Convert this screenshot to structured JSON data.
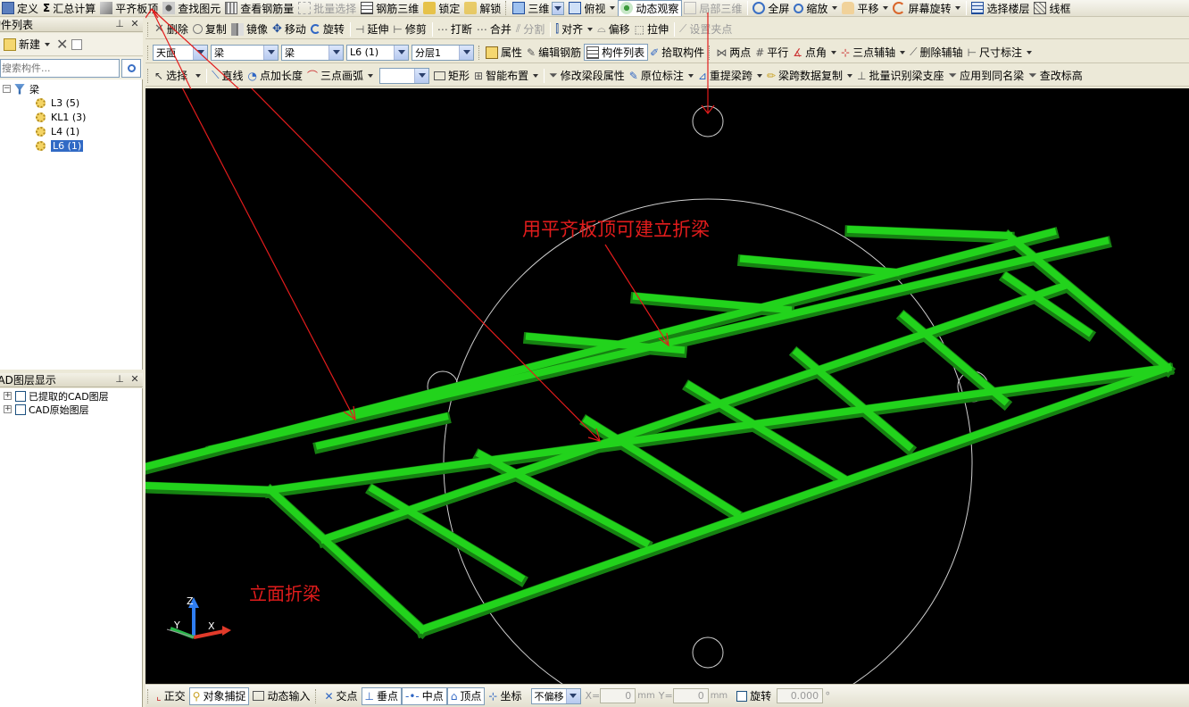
{
  "toolbar1": {
    "define": "定义",
    "sum_calc": "汇总计算",
    "align_board_top": "平齐板顶",
    "find_element": "查找图元",
    "view_rebar_qty": "查看钢筋量",
    "batch_select": "批量选择",
    "rebar_3d": "钢筋三维",
    "lock": "锁定",
    "unlock": "解锁",
    "view_mode": "三维",
    "view_dir": "俯视",
    "dynamic_observe": "动态观察",
    "local_3d": "局部三维",
    "fullscreen": "全屏",
    "zoom": "缩放",
    "pan": "平移",
    "screen_rotate": "屏幕旋转",
    "select_floor": "选择楼层",
    "wireframe": "线框"
  },
  "toolbar2": {
    "delete": "删除",
    "copy": "复制",
    "mirror": "镜像",
    "move": "移动",
    "rotate": "旋转",
    "extend": "延伸",
    "trim": "修剪",
    "break": "打断",
    "merge": "合并",
    "split": "分割",
    "align": "对齐",
    "offset": "偏移",
    "stretch": "拉伸",
    "set_grip": "设置夹点"
  },
  "toolbar3": {
    "floor_combo": "天面",
    "type_combo": "梁",
    "subtype_combo": "梁",
    "component_combo": "L6 (1)",
    "layer_combo": "分层1",
    "properties": "属性",
    "edit_rebar": "编辑钢筋",
    "component_list": "构件列表",
    "pick_component": "拾取构件",
    "two_points": "两点",
    "parallel": "平行",
    "point_angle": "点角",
    "three_point_axis": "三点辅轴",
    "delete_axis": "删除辅轴",
    "dimension": "尺寸标注"
  },
  "toolbar4": {
    "select": "选择",
    "line": "直线",
    "point_length": "点加长度",
    "three_point_arc": "三点画弧",
    "blank_combo": "",
    "rectangle": "矩形",
    "smart_layout": "智能布置",
    "modify_span_props": "修改梁段属性",
    "in_situ_label": "原位标注",
    "re_extract_span": "重提梁跨",
    "span_data_copy": "梁跨数据复制",
    "batch_identify_support": "批量识别梁支座",
    "apply_same_name": "应用到同名梁",
    "check_elevation": "查改标高"
  },
  "component_panel": {
    "title": "构件列表",
    "new_button": "新建",
    "search_placeholder": "搜索构件...",
    "root": "梁",
    "items": [
      "L3 (5)",
      "KL1 (3)",
      "L4 (1)",
      "L6 (1)"
    ],
    "selected_index": 3
  },
  "cad_panel": {
    "title": "CAD图层显示",
    "layers": [
      "已提取的CAD图层",
      "CAD原始图层"
    ]
  },
  "annotations": {
    "main_text": "用平齐板顶可建立折梁",
    "bottom_text": "立面折梁"
  },
  "axes": {
    "z": "Z",
    "y": "Y",
    "x": "X"
  },
  "statusbar": {
    "ortho": "正交",
    "object_snap": "对象捕捉",
    "dynamic_input": "动态输入",
    "intersection": "交点",
    "perpendicular": "垂点",
    "midpoint": "中点",
    "vertex": "顶点",
    "coordinate": "坐标",
    "offset_mode": "不偏移",
    "x_label": "X=",
    "x_value": "0",
    "y_label": "Y=",
    "y_value": "0",
    "unit": "mm",
    "rotate": "旋转",
    "rotate_value": "0.000",
    "degree": "°"
  },
  "colors": {
    "beam_green": "#22d31c",
    "annotation_red": "#e21c1c",
    "viewport_bg": "#000000",
    "selection_blue": "#316ac5"
  }
}
